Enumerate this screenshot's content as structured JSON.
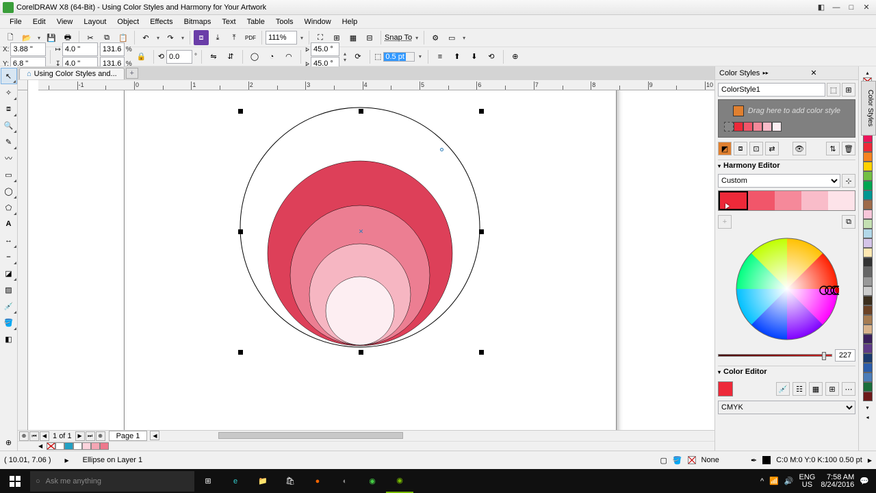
{
  "titlebar": {
    "app": "CorelDRAW X8 (64-Bit)",
    "doc": "Using Color Styles and Harmony for Your Artwork"
  },
  "menu": [
    "File",
    "Edit",
    "View",
    "Layout",
    "Object",
    "Effects",
    "Bitmaps",
    "Text",
    "Table",
    "Tools",
    "Window",
    "Help"
  ],
  "toolbar": {
    "zoom": "111%",
    "snap": "Snap To"
  },
  "propbar": {
    "x": "3.88 \"",
    "y": "6.8 \"",
    "w": "4.0 \"",
    "h": "4.0 \"",
    "sx": "131.6",
    "sy": "131.6",
    "su": "%",
    "rot": "0.0",
    "a1": "45.0 °",
    "a2": "45.0 °",
    "outline": "0.5 pt"
  },
  "doctab": "Using Color Styles and...",
  "ruler_unit": "inches",
  "pager": {
    "page": "1",
    "of": "of",
    "total": "1",
    "page_label": "Page 1"
  },
  "palette_row": [
    "#ffffff",
    "#22a1c4",
    "#ffffff",
    "#fbd3dc",
    "#f4a6b4",
    "#ed798c"
  ],
  "status": {
    "coords": "( 10.01, 7.06 )",
    "obj": "Ellipse on Layer 1",
    "fill_none": "None",
    "cmyk": "C:0 M:0 Y:0 K:100 0.50 pt"
  },
  "docker": {
    "title": "Color Styles",
    "style_name": "ColorStyle1",
    "drag_hint": "Drag here to add color style",
    "swatches": [
      "#8a0e1c",
      "#ed2939",
      "#f1566a",
      "#f5899a",
      "#f9bcc9",
      "#fdeef2"
    ],
    "harmony_title": "Harmony Editor",
    "harmony_type": "Custom",
    "harmony_sw": [
      "#ed2939",
      "#f1566a",
      "#f5899a",
      "#f9bcc9",
      "#fde3e9"
    ],
    "slider_val": "227",
    "color_editor_title": "Color Editor",
    "color_model": "CMYK"
  },
  "right_palette": [
    "#000000",
    "#ffffff",
    "#00a6ce",
    "#004b8d",
    "#5e2d91",
    "#ed145b",
    "#ed2939",
    "#f58220",
    "#ffd200",
    "#72bf44",
    "#00a651",
    "#009792",
    "#a1a1a4",
    "#6b5b95"
  ],
  "docker_tab": "Color Styles",
  "taskbar": {
    "search_ph": "Ask me anything",
    "lang": "ENG",
    "kb": "US",
    "time": "7:58 AM",
    "date": "8/24/2016"
  }
}
